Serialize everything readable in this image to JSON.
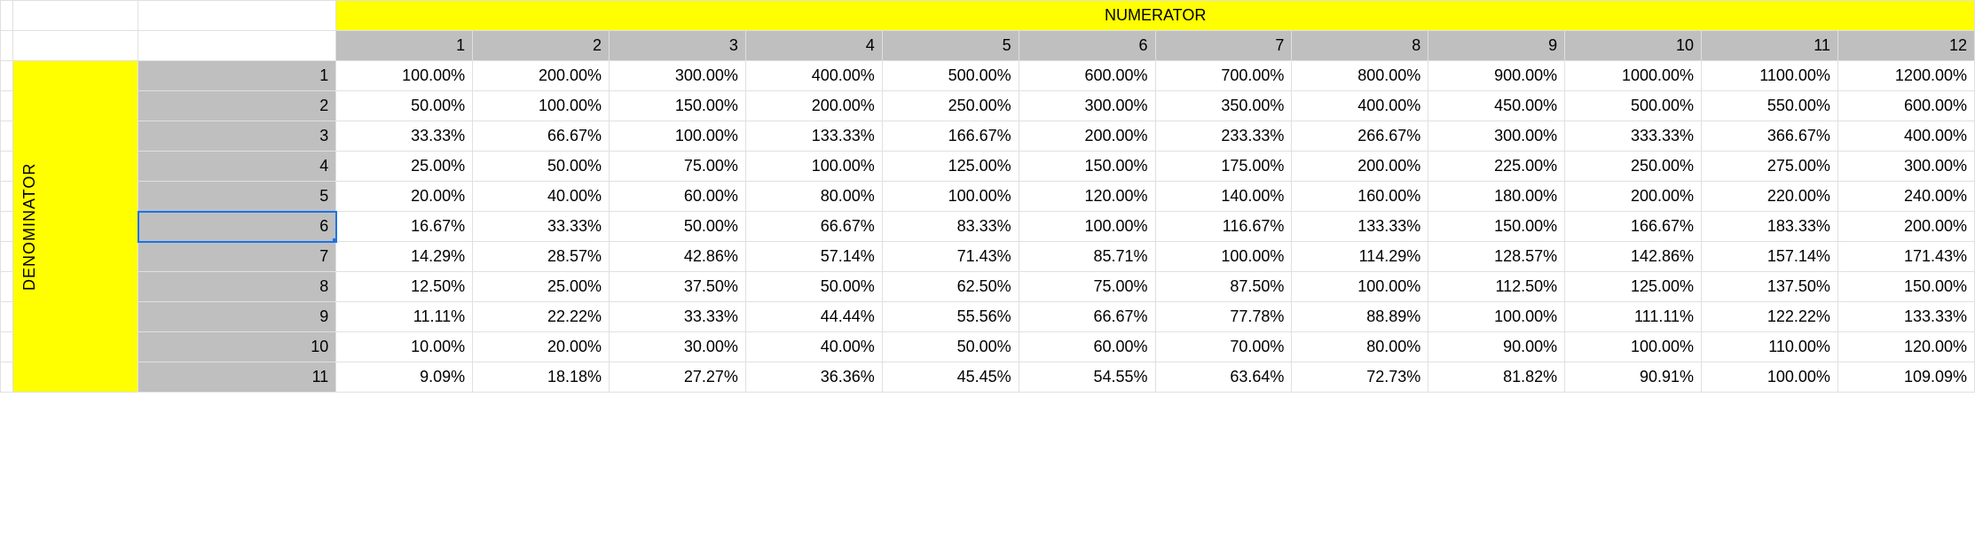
{
  "headers": {
    "numerator_label": "NUMERATOR",
    "denominator_label": "DENOMINATOR",
    "numerators": [
      "1",
      "2",
      "3",
      "4",
      "5",
      "6",
      "7",
      "8",
      "9",
      "10",
      "11",
      "12"
    ]
  },
  "selected_denominator_index": 5,
  "rows": [
    {
      "denom": "1",
      "cells": [
        "100.00%",
        "200.00%",
        "300.00%",
        "400.00%",
        "500.00%",
        "600.00%",
        "700.00%",
        "800.00%",
        "900.00%",
        "1000.00%",
        "1100.00%",
        "1200.00%"
      ]
    },
    {
      "denom": "2",
      "cells": [
        "50.00%",
        "100.00%",
        "150.00%",
        "200.00%",
        "250.00%",
        "300.00%",
        "350.00%",
        "400.00%",
        "450.00%",
        "500.00%",
        "550.00%",
        "600.00%"
      ]
    },
    {
      "denom": "3",
      "cells": [
        "33.33%",
        "66.67%",
        "100.00%",
        "133.33%",
        "166.67%",
        "200.00%",
        "233.33%",
        "266.67%",
        "300.00%",
        "333.33%",
        "366.67%",
        "400.00%"
      ]
    },
    {
      "denom": "4",
      "cells": [
        "25.00%",
        "50.00%",
        "75.00%",
        "100.00%",
        "125.00%",
        "150.00%",
        "175.00%",
        "200.00%",
        "225.00%",
        "250.00%",
        "275.00%",
        "300.00%"
      ]
    },
    {
      "denom": "5",
      "cells": [
        "20.00%",
        "40.00%",
        "60.00%",
        "80.00%",
        "100.00%",
        "120.00%",
        "140.00%",
        "160.00%",
        "180.00%",
        "200.00%",
        "220.00%",
        "240.00%"
      ]
    },
    {
      "denom": "6",
      "cells": [
        "16.67%",
        "33.33%",
        "50.00%",
        "66.67%",
        "83.33%",
        "100.00%",
        "116.67%",
        "133.33%",
        "150.00%",
        "166.67%",
        "183.33%",
        "200.00%"
      ]
    },
    {
      "denom": "7",
      "cells": [
        "14.29%",
        "28.57%",
        "42.86%",
        "57.14%",
        "71.43%",
        "85.71%",
        "100.00%",
        "114.29%",
        "128.57%",
        "142.86%",
        "157.14%",
        "171.43%"
      ]
    },
    {
      "denom": "8",
      "cells": [
        "12.50%",
        "25.00%",
        "37.50%",
        "50.00%",
        "62.50%",
        "75.00%",
        "87.50%",
        "100.00%",
        "112.50%",
        "125.00%",
        "137.50%",
        "150.00%"
      ]
    },
    {
      "denom": "9",
      "cells": [
        "11.11%",
        "22.22%",
        "33.33%",
        "44.44%",
        "55.56%",
        "66.67%",
        "77.78%",
        "88.89%",
        "100.00%",
        "111.11%",
        "122.22%",
        "133.33%"
      ]
    },
    {
      "denom": "10",
      "cells": [
        "10.00%",
        "20.00%",
        "30.00%",
        "40.00%",
        "50.00%",
        "60.00%",
        "70.00%",
        "80.00%",
        "90.00%",
        "100.00%",
        "110.00%",
        "120.00%"
      ]
    },
    {
      "denom": "11",
      "cells": [
        "9.09%",
        "18.18%",
        "27.27%",
        "36.36%",
        "45.45%",
        "54.55%",
        "63.64%",
        "72.73%",
        "81.82%",
        "90.91%",
        "100.00%",
        "109.09%"
      ]
    }
  ]
}
